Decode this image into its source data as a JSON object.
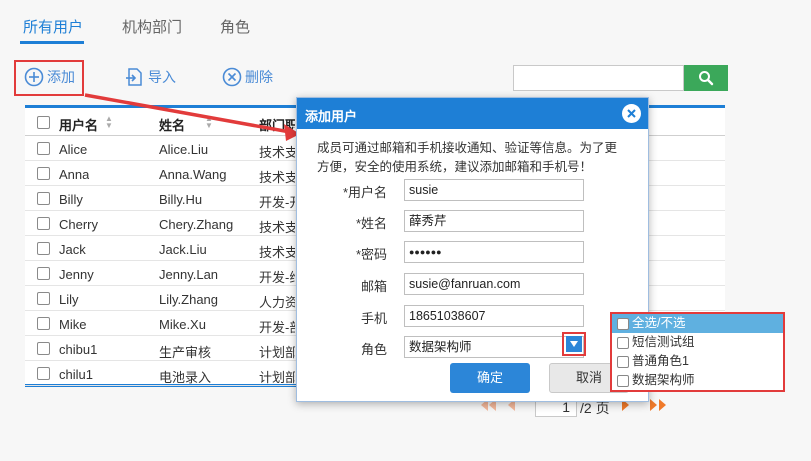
{
  "tabs": [
    "所有用户",
    "机构部门",
    "角色"
  ],
  "toolbar": {
    "add": "添加",
    "import": "导入",
    "delete": "删除"
  },
  "search": {
    "value": "",
    "placeholder": ""
  },
  "table": {
    "headers": [
      "用户名",
      "姓名",
      "部门职"
    ],
    "rows": [
      [
        "Alice",
        "Alice.Liu",
        "技术支"
      ],
      [
        "Anna",
        "Anna.Wang",
        "技术支"
      ],
      [
        "Billy",
        "Billy.Hu",
        "开发-开"
      ],
      [
        "Cherry",
        "Chery.Zhang",
        "技术支"
      ],
      [
        "Jack",
        "Jack.Liu",
        "技术支"
      ],
      [
        "Jenny",
        "Jenny.Lan",
        "开发-维"
      ],
      [
        "Lily",
        "Lily.Zhang",
        "人力资"
      ],
      [
        "Mike",
        "Mike.Xu",
        "开发-部"
      ],
      [
        "chibu1",
        "生产审核",
        "计划部"
      ],
      [
        "chilu1",
        "电池录入",
        "计划部"
      ]
    ]
  },
  "pager": {
    "current": "1",
    "total_text": "/2 页"
  },
  "dialog": {
    "title": "添加用户",
    "notice": "成员可通过邮箱和手机接收通知、验证等信息。为了更方便，安全的使用系统，建议添加邮箱和手机号！",
    "fields": {
      "username": {
        "label": "*用户名",
        "value": "susie"
      },
      "name": {
        "label": "*姓名",
        "value": "薛秀芹"
      },
      "password": {
        "label": "*密码",
        "value": "●●●●●●"
      },
      "email": {
        "label": "邮箱",
        "value": "susie@fanruan.com"
      },
      "phone": {
        "label": "手机",
        "value": "18651038607"
      },
      "role": {
        "label": "角色",
        "value": "数据架构师"
      }
    },
    "ok": "确定",
    "cancel": "取消"
  },
  "role_dropdown": {
    "options": [
      "全选/不选",
      "短信测试组",
      "普通角色1",
      "数据架构师"
    ]
  },
  "colors": {
    "accent": "#1e7fd6",
    "search_green": "#3ba85a",
    "annotation_red": "#e23b3b",
    "pager_orange": "#f07a2a"
  }
}
